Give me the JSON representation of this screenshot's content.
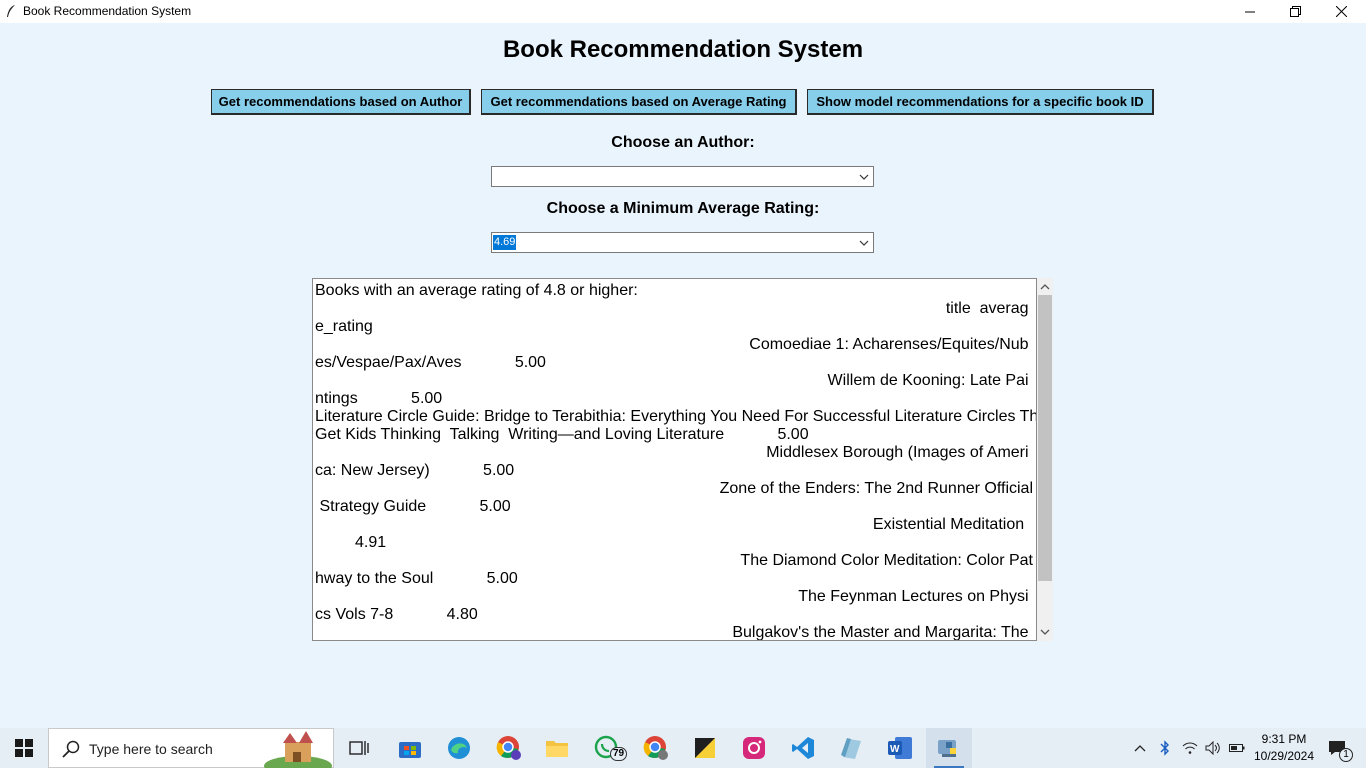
{
  "window": {
    "title": "Book Recommendation System",
    "icons": [
      "feather-icon",
      "minimize-icon",
      "restore-icon",
      "close-icon"
    ]
  },
  "main": {
    "heading": "Book Recommendation System",
    "buttons": {
      "author": "Get recommendations based on Author",
      "rating": "Get recommendations based on Average Rating",
      "book_id": "Show model recommendations for a specific book ID"
    },
    "author_label": "Choose an Author:",
    "author_value": "",
    "rating_label": "Choose a Minimum Average Rating:",
    "rating_value": "4.69"
  },
  "output": {
    "lines": [
      "Books with an average rating of 4.8 or higher:",
      "title  averag ",
      "e_rating",
      "Comoediae 1: Acharenses/Equites/Nub ",
      "es/Vespae/Pax/Aves            5.00",
      "Willem de Kooning: Late Pai ",
      "ntings            5.00",
      "Literature Circle Guide: Bridge to Terabithia: Everything You Need For Successful Literature Circles That",
      "Get Kids Thinking  Talking  Writing—and Loving Literature            5.00",
      "Middlesex Borough (Images of Ameri ",
      "ca: New Jersey)            5.00",
      "Zone of the Enders: The 2nd Runner Official",
      " Strategy Guide            5.00",
      "Existential Meditation  ",
      "         4.91",
      "The Diamond Color Meditation: Color Pat",
      "hway to the Soul            5.00",
      "The Feynman Lectures on Physi ",
      "cs Vols 7-8            4.80",
      "Bulgakov's the Master and Margarita: The "
    ]
  },
  "taskbar": {
    "search_placeholder": "Type here to search",
    "whatsapp_badge": "79",
    "time": "9:31 PM",
    "date": "10/29/2024",
    "notification_count": "1"
  },
  "colors": {
    "background": "#eaf4fd",
    "button": "#87ceeb",
    "selection": "#0078d7"
  }
}
